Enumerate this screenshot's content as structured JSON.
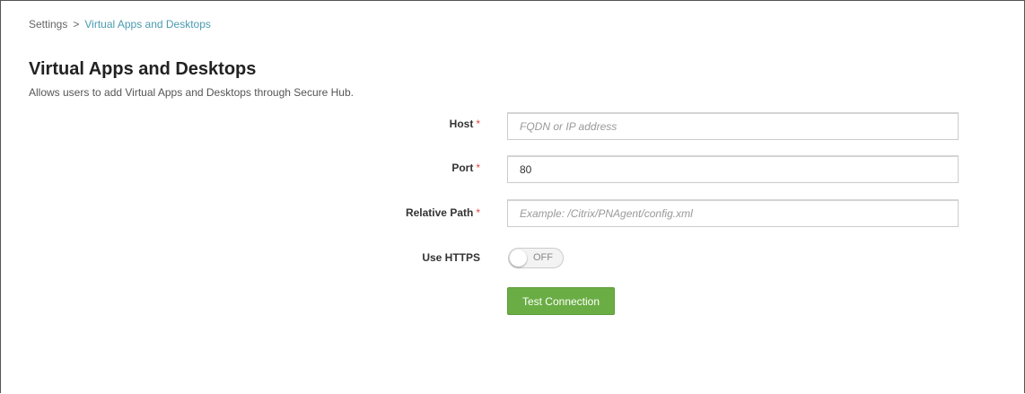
{
  "breadcrumb": {
    "root": "Settings",
    "separator": ">",
    "current": "Virtual Apps and Desktops"
  },
  "page": {
    "title": "Virtual Apps and Desktops",
    "description": "Allows users to add Virtual Apps and Desktops through Secure Hub."
  },
  "form": {
    "required_marker": "*",
    "host": {
      "label": "Host",
      "value": "",
      "placeholder": "FQDN or IP address"
    },
    "port": {
      "label": "Port",
      "value": "80",
      "placeholder": ""
    },
    "relative_path": {
      "label": "Relative Path",
      "value": "",
      "placeholder": "Example: /Citrix/PNAgent/config.xml"
    },
    "use_https": {
      "label": "Use HTTPS",
      "state": "OFF"
    },
    "test_button_label": "Test Connection"
  },
  "colors": {
    "link": "#4a9bb0",
    "required": "#e04a3f",
    "button": "#6aad44"
  }
}
